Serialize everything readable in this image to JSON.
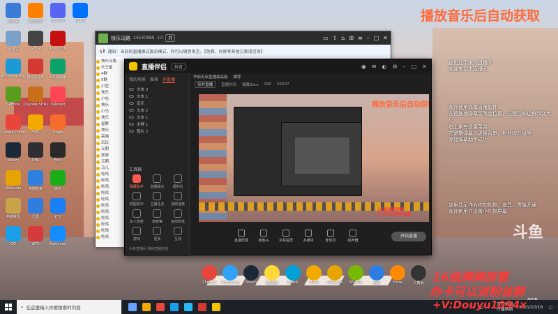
{
  "overlay": {
    "title": "播放音乐后自动获取",
    "side_lines_1": [
      "这里显示永久直播间",
      "欢迎来到本直播间"
    ],
    "side_lines_2": [
      "欢迎使用简单直播软件",
      "左键拖拽弹幕区改变位置，左键拉伸边角改变大",
      "小"
    ],
    "side_lines_3": [
      "右上角有设置菜单",
      "左键拖弹幕，更换背景，粉丝牌升级等",
      "添加弹幕助手成功"
    ],
    "side_lines_4": [
      "这里显示作为你的礼物、道具、贵族开通",
      "欢迎新用户设置小礼物屏幕"
    ],
    "bottom_line_1": "16级牌牌房管",
    "bottom_line_2": "办卡可以进粉丝群",
    "bottom_line_3": "+V:Douyu1094x",
    "count": "995",
    "watermark": "斗鱼"
  },
  "desktop_icons_left": [
    {
      "label": "此电脑",
      "color": "#3a7bd5"
    },
    {
      "label": "回收站",
      "color": "#7aa0c8"
    },
    {
      "label": "Microsoft Edge",
      "color": "#1a9bd8"
    },
    {
      "label": "GeForce",
      "color": "#5a9c1d"
    },
    {
      "label": "Google Chrome",
      "color": "#e8453c"
    },
    {
      "label": "Steam",
      "color": "#1b2838"
    },
    {
      "label": "WeGame",
      "color": "#e6a400"
    },
    {
      "label": "英雄联盟",
      "color": "#c7a44a"
    },
    {
      "label": "QQ",
      "color": "#1aa0e8"
    },
    {
      "label": "腾讯视频",
      "color": "#ff7f00"
    },
    {
      "label": "GPU-Z",
      "color": "#444"
    },
    {
      "label": "网易云音乐",
      "color": "#d33a31"
    },
    {
      "label": "Counter-Strike",
      "color": "#c96f1c"
    },
    {
      "label": "PUBG",
      "color": "#f2a900"
    },
    {
      "label": "OBS",
      "color": "#302e31"
    },
    {
      "label": "电脑管家",
      "color": "#2e7fe0"
    },
    {
      "label": "迅雷",
      "color": "#2f7de1"
    },
    {
      "label": "WPS",
      "color": "#d63b3b"
    },
    {
      "label": "Discord",
      "color": "#5865f2"
    },
    {
      "label": "Among Us",
      "color": "#c51111"
    },
    {
      "label": "UU加速器",
      "color": "#0aa36b"
    },
    {
      "label": "Valorant",
      "color": "#ff4655"
    },
    {
      "label": "Origin",
      "color": "#f56c2d"
    },
    {
      "label": "Epic",
      "color": "#2a2a2a"
    },
    {
      "label": "微信",
      "color": "#1aad19"
    },
    {
      "label": "钉钉",
      "color": "#1a7ef5"
    },
    {
      "label": "Battle.net",
      "color": "#148eff"
    },
    {
      "label": "Uplay",
      "color": "#0070ff"
    }
  ],
  "chat_window": {
    "name": "快乐马路",
    "id": "24540889",
    "stats": "13",
    "btn": "开",
    "notice": "通知：当前的直播模式复杂模式，你可以随意发言。【免费、同屏等其他方案请咨询】",
    "list": [
      "快乐马路",
      "天王星",
      "4群",
      "5群",
      "小型",
      "快乐",
      "小包",
      "快乐",
      "小马",
      "快乐",
      "星群",
      "快乐",
      "高端",
      "玩玩",
      "五期",
      "爱游",
      "五期",
      "马儿",
      "吃鸡",
      "吃鸡",
      "吃鸡",
      "吃鸡",
      "吃鸡",
      "吃鸡",
      "吃鸡",
      "吃鸡",
      "吃鸡",
      "吃鸡",
      "吃鸡"
    ]
  },
  "stream_app": {
    "brand": "直播伴侣",
    "tag": "抖音",
    "left_tabs": [
      "我的场景",
      "图表",
      "开直播"
    ],
    "layers": [
      "文本 3",
      "文本 1",
      "音乐",
      "文本 2",
      "文本 1",
      "全屏 1",
      "图片 2"
    ],
    "tools_header": "工具箱",
    "tools": [
      {
        "label": "弹幕助手",
        "hot": true
      },
      {
        "label": "直播提示",
        "hot": false
      },
      {
        "label": "福利社",
        "hot": false
      },
      {
        "label": "截图发布",
        "hot": false
      },
      {
        "label": "主播任务",
        "hot": false
      },
      {
        "label": "视频连麦",
        "hot": false
      },
      {
        "label": "多人连麦",
        "hot": false
      },
      {
        "label": "连麦等",
        "hot": false
      },
      {
        "label": "虚拟形象",
        "hot": false
      },
      {
        "label": "游戏",
        "hot": false
      },
      {
        "label": "更多",
        "hot": false
      },
      {
        "label": "互动",
        "hot": false
      }
    ],
    "footer": "头条直播间 我的直播信息",
    "top_tabs": [
      "学前无双直播最高级",
      "推荐"
    ],
    "info_chip": "实时直播",
    "info_items": [
      "直播时间",
      "弹幕Zero",
      "995",
      "56547"
    ],
    "preview_title": "播放音乐后自动获取",
    "preview_red": [
      "16级牌牌房管",
      "办卡可以进粉丝群"
    ],
    "bottom_buttons": [
      "直播屏幕",
      "摄像头",
      "手机投屏",
      "多媒体",
      "麦克风",
      "扬声器"
    ],
    "start_label": "开始直播"
  },
  "bottom_icons": [
    {
      "label": "Chrome",
      "color": "#e8453c"
    },
    {
      "label": "Photoshop",
      "color": "#2fa3f7"
    },
    {
      "label": "Steam",
      "color": "#1b2838"
    },
    {
      "label": "QQ音乐",
      "color": "#ffd83a"
    },
    {
      "label": "Bilibili",
      "color": "#00a1d6"
    },
    {
      "label": "PUBG",
      "color": "#f2a900"
    },
    {
      "label": "WeGame",
      "color": "#e6a400"
    },
    {
      "label": "NVIDIA",
      "color": "#76b900"
    },
    {
      "label": "迅雷",
      "color": "#2f7de1"
    },
    {
      "label": "Forza",
      "color": "#ff8a00"
    },
    {
      "label": "三角洲",
      "color": "#333"
    }
  ],
  "taskbar": {
    "search_placeholder": "在这里输入你要搜索的内容",
    "apps": [
      "#6aa2ff",
      "#f2a900",
      "#e8453c",
      "#1aa0e8",
      "#29b6f6",
      "#d33a31",
      "#f5c400"
    ],
    "tray_status": "正在使用",
    "tray_note": "传播网络",
    "date": "2021/10/16"
  }
}
